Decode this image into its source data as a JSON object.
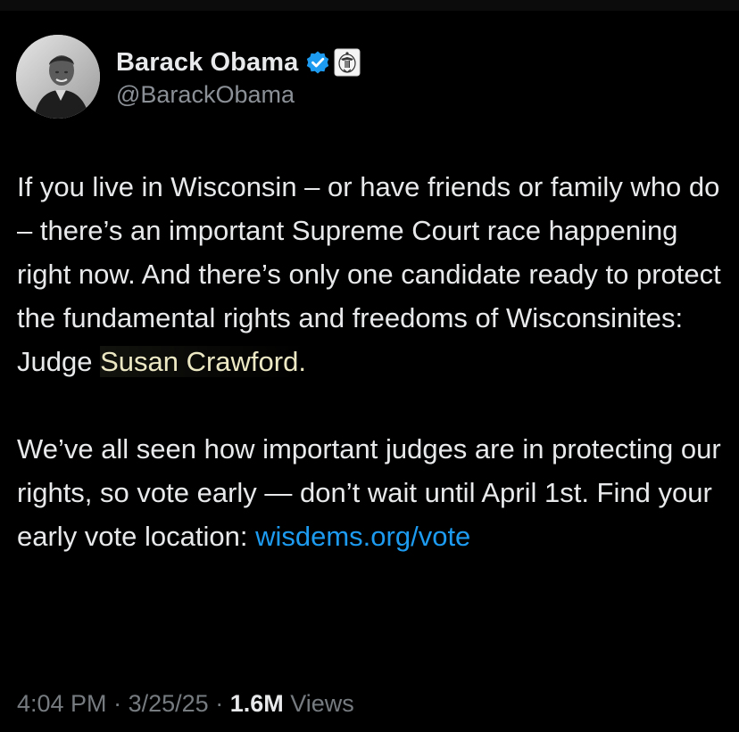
{
  "author": {
    "display_name": "Barack Obama",
    "handle": "@BarackObama",
    "verified": true
  },
  "tweet": {
    "paragraph1": "If you live in Wisconsin – or have friends or family who do – there’s an important Supreme Court race happening right now. And there’s only one candidate ready to protect the fundamental rights and freedoms of Wisconsinites: Judge ",
    "highlighted_name": "Susan Crawford.",
    "paragraph2": "We’ve all seen how important judges are in protecting our rights, so vote early — don’t wait until April 1st. Find your early vote location: ",
    "link": "wisdems.org/vote"
  },
  "meta": {
    "time": "4:04 PM",
    "date": "3/25/25",
    "separator": "·",
    "views_count": "1.6M",
    "views_label": "Views"
  },
  "colors": {
    "background": "#000000",
    "text": "#e7e9ea",
    "secondary": "#8b9096",
    "link": "#1d9bf0",
    "verified": "#1d9bf0"
  },
  "icons": {
    "verified": "verified-badge-icon",
    "affiliation": "us-government-seal-icon"
  }
}
